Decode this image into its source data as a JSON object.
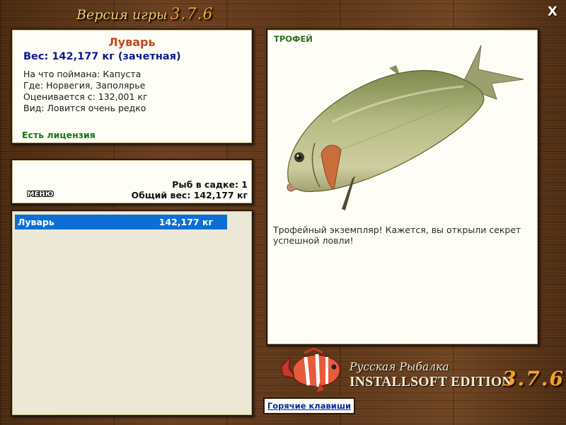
{
  "window": {
    "title": "Версия игры",
    "version": "3.7.6",
    "close_label": "X"
  },
  "fish_info": {
    "name": "Луварь",
    "weight": "Вес: 142,177 кг (зачетная)",
    "details": [
      "На что поймана: Капуста",
      "Где: Норвегия, Заполярье",
      "Оценивается с: 132,001 кг",
      "Вид: Ловится очень редко"
    ],
    "license": "Есть лицензия"
  },
  "keepnet": {
    "menu_label": "МЕНЮ",
    "fish_count": "Рыб в садке: 1",
    "total_weight": "Общий вес: 142,177 кг"
  },
  "catch_list": [
    {
      "name": "Луварь",
      "weight": "142,177 кг",
      "selected": true
    }
  ],
  "trophy": {
    "tag": "ТРОФЕЙ",
    "description": "Трофейный экземпляр! Кажется, вы открыли секрет успешной ловли!",
    "fish_image": "opah-fish-image"
  },
  "branding": {
    "game_name": "Русская Рыбалка",
    "edition": "INSTALLSOFT EDITION",
    "version": "3.7.6",
    "logo": "red-striped-fish-logo"
  },
  "hotkeys_label": "Горячие клавиши",
  "colors": {
    "fish_name": "#c4481a",
    "weight": "#0a1a8c",
    "license": "#127a18",
    "selection": "#0d6fd6",
    "version_accent": "#f5a02c"
  }
}
